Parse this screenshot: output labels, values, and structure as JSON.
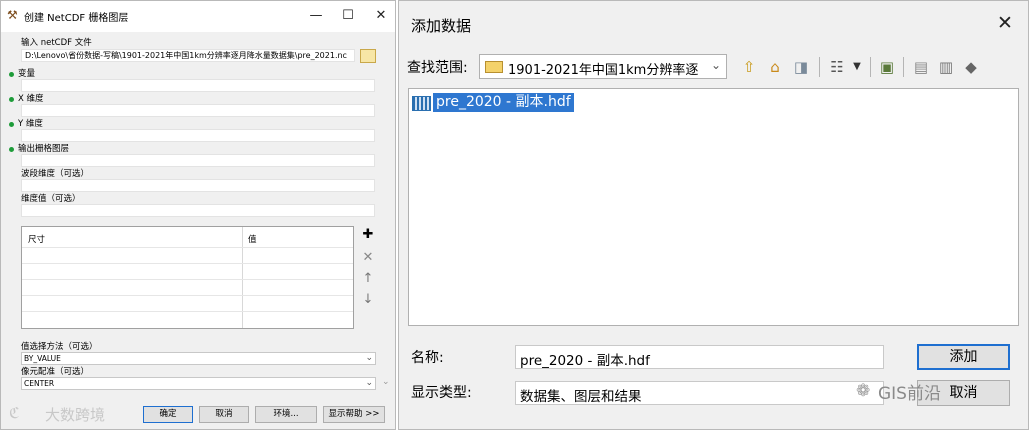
{
  "left_window": {
    "title": "创建 NetCDF 栅格图层",
    "controls": {
      "minimize": "—",
      "maximize": "☐",
      "close": "✕"
    },
    "input_label": "输入 netCDF 文件",
    "input_value": "D:\\Lenovo\\省份数据-写稿\\1901-2021年中国1km分辨率逐月降水量数据集\\pre_2021.nc",
    "variable_label": "变量",
    "x_dim_label": "X 维度",
    "y_dim_label": "Y 维度",
    "output_label": "输出栅格图层",
    "band_dim_label": "波段维度（可选）",
    "dim_values_label": "维度值（可选）",
    "table": {
      "columns": [
        "尺寸",
        "值"
      ]
    },
    "value_method_label": "值选择方法（可选）",
    "value_method_value": "BY_VALUE",
    "cell_registration_label": "像元配准（可选）",
    "cell_registration_value": "CENTER",
    "buttons": {
      "ok": "确定",
      "cancel": "取消",
      "env": "环境...",
      "help": "显示帮助 >>"
    },
    "watermark": "大数跨境",
    "icons": {
      "add": "plus-icon",
      "delete": "x-icon",
      "up": "arrow-up-icon",
      "down": "arrow-down-icon"
    }
  },
  "right_dialog": {
    "title": "添加数据",
    "close": "✕",
    "look_in_label": "查找范围:",
    "look_in_value": "1901-2021年中国1km分辨率逐",
    "file_name": "pre_2020 - 副本.hdf",
    "name_label": "名称:",
    "name_value": "pre_2020 - 副本.hdf",
    "type_label": "显示类型:",
    "type_value": "数据集、图层和结果",
    "add_button": "添加",
    "cancel_button": "取消",
    "watermark": "GIS前沿",
    "accent": "#2e77d0"
  }
}
